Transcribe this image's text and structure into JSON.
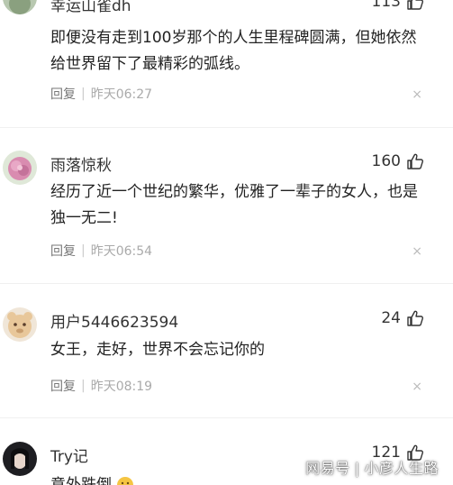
{
  "comments": [
    {
      "username": "幸运山雀dh",
      "likes": "113",
      "text": "即便没有走到100岁那个的人生里程碑圆满，但她依然给世界留下了最精彩的弧线。",
      "reply_label": "回复",
      "time": "昨天06:27"
    },
    {
      "username": "雨落惊秋",
      "likes": "160",
      "text": "经历了近一个世纪的繁华，优雅了一辈子的女人，也是独一无二!",
      "reply_label": "回复",
      "time": "昨天06:54"
    },
    {
      "username": "用户5446623594",
      "likes": "24",
      "text": "女王，走好，世界不会忘记你的",
      "reply_label": "回复",
      "time": "昨天08:19"
    },
    {
      "username": "Try记",
      "likes": "121",
      "text": "意外跌倒"
    }
  ],
  "close_symbol": "×",
  "watermark": {
    "brand": "网易号",
    "author": "小彦人生路"
  },
  "colors": {
    "text": "#222222",
    "meta": "#888888",
    "divider": "#f0f0f0"
  }
}
